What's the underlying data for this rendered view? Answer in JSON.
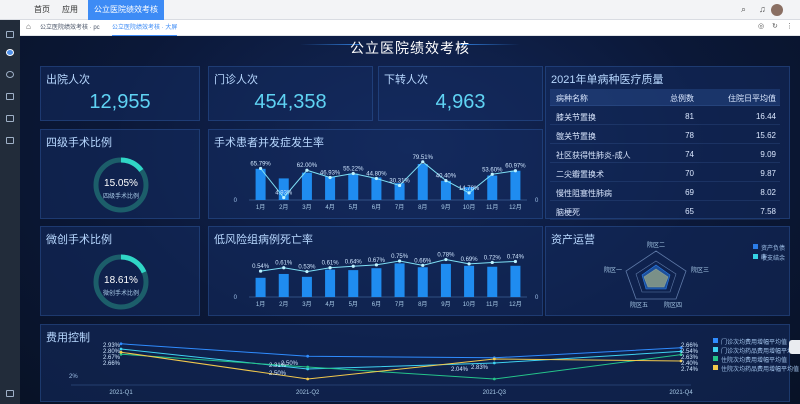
{
  "tabs": [
    "首页",
    "应用",
    "公立医院绩效考核"
  ],
  "breadcrumbs": [
    "公立医院绩效考核 · pc",
    "公立医院绩效考核 · 大屏"
  ],
  "title": "公立医院绩效考核",
  "kpis": [
    {
      "label": "出院人次",
      "value": "12,955"
    },
    {
      "label": "门诊人次",
      "value": "454,358"
    },
    {
      "label": "下转人次",
      "value": "4,963"
    }
  ],
  "ring1": {
    "title": "四级手术比例",
    "pct": "15.05%",
    "sub": "四级手术比例",
    "fraction": 0.1505
  },
  "ring2": {
    "title": "微创手术比例",
    "pct": "18.61%",
    "sub": "微创手术比例",
    "fraction": 0.1861
  },
  "surgery": {
    "title": "手术患者并发症发生率",
    "months": [
      "1月",
      "2月",
      "3月",
      "4月",
      "5月",
      "6月",
      "7月",
      "8月",
      "9月",
      "10月",
      "11月",
      "12月"
    ],
    "bars": [
      65,
      45,
      57,
      49,
      55,
      47,
      35,
      75,
      40,
      27,
      51,
      61
    ],
    "line": [
      65.79,
      4.93,
      62.0,
      46.93,
      55.22,
      44.8,
      30.31,
      79.51,
      40.4,
      14.78,
      53.6,
      60.97
    ],
    "labels": [
      "65.79%",
      "4.93%",
      "62.00%",
      "46.93%",
      "55.22%",
      "44.80%",
      "30.31%",
      "79.51%",
      "40.40%",
      "14.78%",
      "53.60%",
      "60.97%"
    ],
    "ymin": "0",
    "ymax": "100",
    "rmin": "0"
  },
  "mortality": {
    "title": "低风险组病例死亡率",
    "months": [
      "1月",
      "2月",
      "3月",
      "4月",
      "5月",
      "6月",
      "7月",
      "8月",
      "9月",
      "10月",
      "11月",
      "12月"
    ],
    "bars": [
      400,
      480,
      420,
      570,
      560,
      600,
      700,
      620,
      690,
      650,
      630,
      650
    ],
    "line": [
      0.54,
      0.61,
      0.53,
      0.61,
      0.64,
      0.67,
      0.75,
      0.66,
      0.78,
      0.69,
      0.72,
      0.74
    ],
    "labels": [
      "0.54%",
      "0.61%",
      "0.53%",
      "0.61%",
      "0.64%",
      "0.67%",
      "0.75%",
      "0.66%",
      "0.78%",
      "0.69%",
      "0.72%",
      "0.74%"
    ],
    "ymin": "0",
    "ymax": "1000",
    "rmin": "0"
  },
  "quality": {
    "title": "2021年单病种医疗质量",
    "headers": [
      "病种名称",
      "总例数",
      "住院日平均值"
    ],
    "rows": [
      [
        "膝关节置换",
        "81",
        "16.44"
      ],
      [
        "髋关节置换",
        "78",
        "15.62"
      ],
      [
        "社区获得性肺炎-成人",
        "74",
        "9.09"
      ],
      [
        "二尖瓣置换术",
        "70",
        "9.87"
      ],
      [
        "慢性阻塞性肺病",
        "69",
        "8.02"
      ],
      [
        "脑梗死",
        "65",
        "7.58"
      ]
    ]
  },
  "assets": {
    "title": "资产运营",
    "axes": [
      "院区二",
      "院区三",
      "院区四",
      "院区五",
      "院区一"
    ],
    "legend": [
      "资产负债率",
      "收支结余"
    ],
    "colors": [
      "#2b7de9",
      "#35d3e6"
    ]
  },
  "cost": {
    "title": "费用控制",
    "quarters": [
      "2021-Q1",
      "2021-Q2",
      "2021-Q3",
      "2021-Q4"
    ],
    "ylabel": "2%",
    "series": [
      {
        "name": "门诊次均费用增幅平均值",
        "color": "#2f8cff",
        "values": [
          2.93,
          2.62,
          2.58,
          2.83
        ]
      },
      {
        "name": "门诊次均药品费用增幅平均值",
        "color": "#3fd2f0",
        "values": [
          2.8,
          2.3,
          2.45,
          2.74
        ]
      },
      {
        "name": "住院次均费用增幅平均值",
        "color": "#25c48a",
        "values": [
          2.67,
          2.35,
          2.05,
          2.66
        ]
      },
      {
        "name": "住院次均药品费用增幅平均值",
        "color": "#f2c94c",
        "values": [
          2.72,
          2.05,
          2.55,
          2.5
        ]
      }
    ],
    "labels": [
      "2.93%",
      "2.80%",
      "2.67%",
      "2.66%",
      "2.54%",
      "2.63%",
      "2.40%",
      "2.31%",
      "2.50%",
      "2.04%",
      "2.83%",
      "2.74%",
      "2.66%",
      "2.50%"
    ]
  }
}
